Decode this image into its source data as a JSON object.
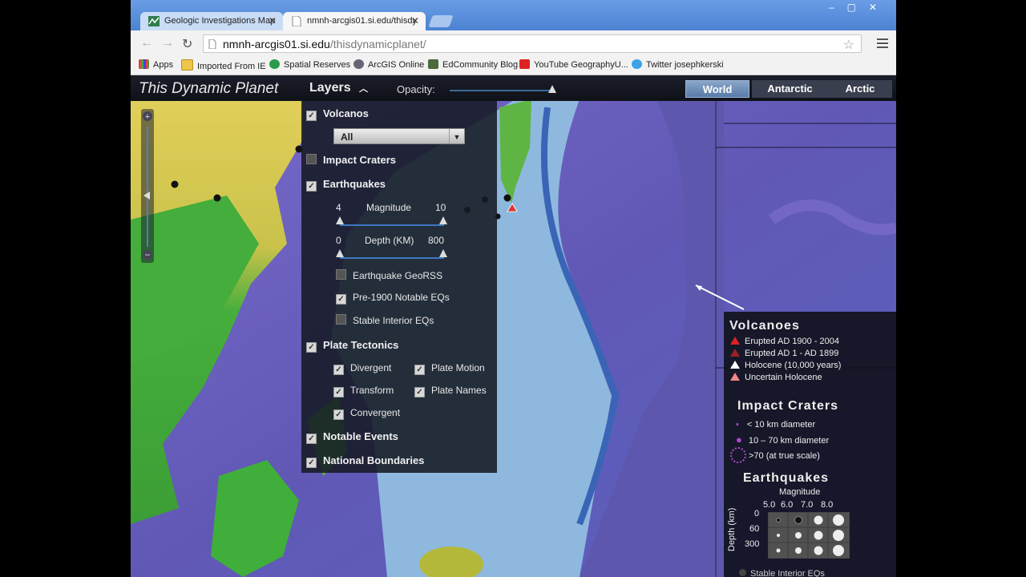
{
  "browser": {
    "tabs": [
      {
        "title": "Geologic Investigations Map",
        "active": false
      },
      {
        "title": "nmnh-arcgis01.si.edu/thisdy",
        "active": true
      }
    ],
    "url_host": "nmnh-arcgis01.si.edu",
    "url_path": "/thisdynamicplanet/",
    "bookmarks": [
      "Apps",
      "Imported From IE",
      "Spatial Reserves",
      "ArcGIS Online",
      "EdCommunity Blog",
      "YouTube GeographyU...",
      "Twitter josephkerski"
    ]
  },
  "app": {
    "title": "This Dynamic Planet",
    "layers_label": "Layers",
    "opacity_label": "Opacity:",
    "regions": [
      "World",
      "Antarctic",
      "Arctic"
    ],
    "active_region": "World"
  },
  "panel": {
    "volcanos": {
      "label": "Volcanos",
      "checked": true,
      "filter": "All"
    },
    "impact_craters": {
      "label": "Impact Craters",
      "checked": false
    },
    "earthquakes": {
      "label": "Earthquakes",
      "checked": true,
      "magnitude_label": "Magnitude",
      "mag_min": "4",
      "mag_max": "10",
      "depth_label": "Depth (KM)",
      "depth_min": "0",
      "depth_max": "800",
      "sub": [
        {
          "label": "Earthquake GeoRSS",
          "checked": false
        },
        {
          "label": "Pre-1900 Notable EQs",
          "checked": true
        },
        {
          "label": "Stable Interior EQs",
          "checked": false
        }
      ]
    },
    "plate_tectonics": {
      "label": "Plate Tectonics",
      "checked": true,
      "divergent": "Divergent",
      "plate_motion": "Plate Motion",
      "transform": "Transform",
      "plate_names": "Plate Names",
      "convergent": "Convergent"
    },
    "notable_events": {
      "label": "Notable Events",
      "checked": true
    },
    "national_boundaries": {
      "label": "National Boundaries",
      "checked": true
    }
  },
  "legend": {
    "volcanoes_title": "Volcanoes",
    "volcano_items": [
      "Erupted AD 1900 - 2004",
      "Erupted AD 1 - AD 1899",
      "Holocene (10,000 years)",
      "Uncertain Holocene"
    ],
    "craters_title": "Impact Craters",
    "crater_items": [
      "< 10 km diameter",
      "10 – 70 km diameter",
      ">70 (at true scale)"
    ],
    "eq_title": "Earthquakes",
    "eq_magnitude": "Magnitude",
    "eq_mags": [
      "5.0",
      "6.0",
      "7.0",
      "8.0"
    ],
    "eq_depth": "Depth (km)",
    "eq_depths": [
      "0",
      "60",
      "300"
    ],
    "stable_interior": "Stable Interior EQs"
  },
  "colors": {
    "land_green": "#3fae3a",
    "land_yellow": "#e3d35a",
    "ocean_deep": "#6a5fc0",
    "ocean_shallow": "#8fb8df",
    "trench": "#3a64b6"
  }
}
